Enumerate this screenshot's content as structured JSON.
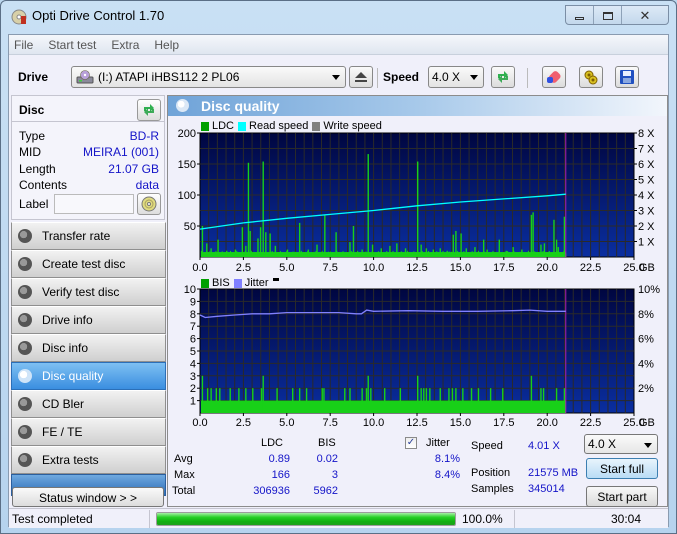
{
  "window": {
    "title": "Opti Drive Control 1.70",
    "controls": {
      "minimize": "minimize",
      "maximize": "maximize",
      "close": "close"
    }
  },
  "menu": [
    "File",
    "Start test",
    "Extra",
    "Help"
  ],
  "toolbar": {
    "drive_label": "Drive",
    "drive_value": "(I:)   ATAPI iHBS112   2 PL06",
    "speed_label": "Speed",
    "speed_value": "4.0 X",
    "icons": [
      "eject-icon",
      "refresh-icon",
      "erase-icon",
      "settings-icon",
      "save-icon"
    ]
  },
  "disc": {
    "title": "Disc",
    "rows": [
      {
        "key": "Type",
        "value": "BD-R"
      },
      {
        "key": "MID",
        "value": "MEIRA1 (001)"
      },
      {
        "key": "Length",
        "value": "21.07 GB"
      },
      {
        "key": "Contents",
        "value": "data"
      }
    ],
    "label_key": "Label",
    "label_value": ""
  },
  "nav": [
    {
      "label": "Transfer rate",
      "active": false
    },
    {
      "label": "Create test disc",
      "active": false
    },
    {
      "label": "Verify test disc",
      "active": false
    },
    {
      "label": "Drive info",
      "active": false
    },
    {
      "label": "Disc info",
      "active": false
    },
    {
      "label": "Disc quality",
      "active": true
    },
    {
      "label": "CD Bler",
      "active": false
    },
    {
      "label": "FE / TE",
      "active": false
    },
    {
      "label": "Extra tests",
      "active": false
    }
  ],
  "status_window_button": "Status window > >",
  "panel": {
    "title": "Disc quality"
  },
  "colors": {
    "ldc": "#00a000",
    "bis": "#00a000",
    "read_speed": "#00ffff",
    "write_speed": "#808080",
    "jitter": "#8080ff",
    "bar": "#18d018",
    "plot_bg_top": "#000640",
    "plot_bg_bottom": "#0a2ea0",
    "marker": "#b020b0",
    "value_text": "#1414c8"
  },
  "chart_data": [
    {
      "type": "bar",
      "title": "",
      "legend": [
        {
          "name": "LDC",
          "color": "#00a000"
        },
        {
          "name": "Read speed",
          "color": "#00ffff"
        },
        {
          "name": "Write speed",
          "color": "#808080"
        }
      ],
      "legend_position": "top-left",
      "xlabel": "GB",
      "xlim": [
        0,
        25
      ],
      "x_ticks": [
        "0.0",
        "2.5",
        "5.0",
        "7.5",
        "10.0",
        "12.5",
        "15.0",
        "17.5",
        "20.0",
        "22.5",
        "25.0"
      ],
      "ylim": [
        0,
        200
      ],
      "y_ticks": [
        "50",
        "100",
        "150",
        "200"
      ],
      "y2lim": [
        0,
        8
      ],
      "y2_ticks": [
        "1 X",
        "2 X",
        "3 X",
        "4 X",
        "5 X",
        "6 X",
        "7 X",
        "8 X"
      ],
      "grid": true,
      "end_marker_gb": 21.07,
      "series": [
        {
          "name": "LDC",
          "kind": "bar",
          "baseline": 8,
          "spikes": [
            {
              "x": 0.1,
              "y": 50
            },
            {
              "x": 0.35,
              "y": 22
            },
            {
              "x": 0.6,
              "y": 14
            },
            {
              "x": 1.0,
              "y": 28
            },
            {
              "x": 1.5,
              "y": 10
            },
            {
              "x": 2.0,
              "y": 12
            },
            {
              "x": 2.4,
              "y": 48
            },
            {
              "x": 2.6,
              "y": 18
            },
            {
              "x": 2.75,
              "y": 152
            },
            {
              "x": 2.85,
              "y": 42
            },
            {
              "x": 3.3,
              "y": 30
            },
            {
              "x": 3.45,
              "y": 48
            },
            {
              "x": 3.6,
              "y": 154
            },
            {
              "x": 3.75,
              "y": 40
            },
            {
              "x": 4.0,
              "y": 38
            },
            {
              "x": 4.3,
              "y": 18
            },
            {
              "x": 5.0,
              "y": 12
            },
            {
              "x": 5.7,
              "y": 55
            },
            {
              "x": 6.2,
              "y": 12
            },
            {
              "x": 6.7,
              "y": 20
            },
            {
              "x": 7.15,
              "y": 68
            },
            {
              "x": 7.8,
              "y": 40
            },
            {
              "x": 8.6,
              "y": 24
            },
            {
              "x": 8.8,
              "y": 50
            },
            {
              "x": 9.3,
              "y": 12
            },
            {
              "x": 9.65,
              "y": 166
            },
            {
              "x": 9.9,
              "y": 20
            },
            {
              "x": 10.4,
              "y": 14
            },
            {
              "x": 10.9,
              "y": 18
            },
            {
              "x": 11.3,
              "y": 22
            },
            {
              "x": 11.8,
              "y": 14
            },
            {
              "x": 12.5,
              "y": 154
            },
            {
              "x": 12.7,
              "y": 20
            },
            {
              "x": 13.0,
              "y": 14
            },
            {
              "x": 13.4,
              "y": 12
            },
            {
              "x": 13.8,
              "y": 14
            },
            {
              "x": 14.2,
              "y": 10
            },
            {
              "x": 14.55,
              "y": 36
            },
            {
              "x": 14.7,
              "y": 42
            },
            {
              "x": 15.0,
              "y": 38
            },
            {
              "x": 15.3,
              "y": 14
            },
            {
              "x": 15.8,
              "y": 16
            },
            {
              "x": 16.3,
              "y": 28
            },
            {
              "x": 16.5,
              "y": 12
            },
            {
              "x": 17.2,
              "y": 28
            },
            {
              "x": 17.6,
              "y": 10
            },
            {
              "x": 18.0,
              "y": 16
            },
            {
              "x": 18.5,
              "y": 12
            },
            {
              "x": 19.05,
              "y": 68
            },
            {
              "x": 19.15,
              "y": 72
            },
            {
              "x": 19.6,
              "y": 20
            },
            {
              "x": 19.8,
              "y": 22
            },
            {
              "x": 20.35,
              "y": 60
            },
            {
              "x": 20.5,
              "y": 28
            },
            {
              "x": 20.6,
              "y": 16
            },
            {
              "x": 20.95,
              "y": 65
            }
          ]
        },
        {
          "name": "Read speed",
          "kind": "line",
          "axis": "y2",
          "x": [
            0,
            2.5,
            5,
            7.5,
            10,
            12.5,
            15,
            17.5,
            20,
            21.07
          ],
          "y": [
            1.8,
            2.2,
            2.5,
            2.75,
            3.0,
            3.3,
            3.55,
            3.75,
            3.95,
            4.05
          ]
        }
      ]
    },
    {
      "type": "bar",
      "title": "",
      "legend": [
        {
          "name": "BIS",
          "color": "#00a000"
        },
        {
          "name": "Jitter",
          "color": "#8080ff"
        }
      ],
      "legend_position": "top-left",
      "xlabel": "GB",
      "xlim": [
        0,
        25
      ],
      "x_ticks": [
        "0.0",
        "2.5",
        "5.0",
        "7.5",
        "10.0",
        "12.5",
        "15.0",
        "17.5",
        "20.0",
        "22.5",
        "25.0"
      ],
      "ylim": [
        0,
        10
      ],
      "y_ticks": [
        "1",
        "2",
        "3",
        "4",
        "5",
        "6",
        "7",
        "8",
        "9",
        "10"
      ],
      "y2lim": [
        0,
        10
      ],
      "y2_ticks": [
        "2%",
        "4%",
        "6%",
        "8%",
        "10%"
      ],
      "grid": true,
      "end_marker_gb": 21.07,
      "series": [
        {
          "name": "BIS",
          "kind": "bar",
          "baseline": 1,
          "spikes": [
            {
              "x": 0.1,
              "y": 3
            },
            {
              "x": 0.4,
              "y": 2
            },
            {
              "x": 0.6,
              "y": 2
            },
            {
              "x": 0.9,
              "y": 2
            },
            {
              "x": 1.1,
              "y": 2
            },
            {
              "x": 1.7,
              "y": 2
            },
            {
              "x": 2.2,
              "y": 2
            },
            {
              "x": 2.6,
              "y": 2
            },
            {
              "x": 3.0,
              "y": 2
            },
            {
              "x": 3.5,
              "y": 2
            },
            {
              "x": 3.6,
              "y": 3
            },
            {
              "x": 4.4,
              "y": 2
            },
            {
              "x": 5.3,
              "y": 2
            },
            {
              "x": 5.7,
              "y": 2
            },
            {
              "x": 6.1,
              "y": 2
            },
            {
              "x": 7.0,
              "y": 2
            },
            {
              "x": 7.1,
              "y": 2
            },
            {
              "x": 8.3,
              "y": 2
            },
            {
              "x": 8.6,
              "y": 2
            },
            {
              "x": 9.3,
              "y": 2
            },
            {
              "x": 9.55,
              "y": 2
            },
            {
              "x": 9.65,
              "y": 3
            },
            {
              "x": 9.8,
              "y": 2
            },
            {
              "x": 10.6,
              "y": 2
            },
            {
              "x": 11.5,
              "y": 2
            },
            {
              "x": 12.5,
              "y": 3
            },
            {
              "x": 12.7,
              "y": 2
            },
            {
              "x": 12.85,
              "y": 2
            },
            {
              "x": 13.0,
              "y": 2
            },
            {
              "x": 13.2,
              "y": 2
            },
            {
              "x": 13.8,
              "y": 2
            },
            {
              "x": 14.3,
              "y": 2
            },
            {
              "x": 14.5,
              "y": 2
            },
            {
              "x": 14.7,
              "y": 2
            },
            {
              "x": 15.1,
              "y": 2
            },
            {
              "x": 15.6,
              "y": 2
            },
            {
              "x": 16.0,
              "y": 2
            },
            {
              "x": 16.7,
              "y": 2
            },
            {
              "x": 17.4,
              "y": 2
            },
            {
              "x": 19.05,
              "y": 3
            },
            {
              "x": 19.6,
              "y": 2
            },
            {
              "x": 19.75,
              "y": 2
            },
            {
              "x": 20.5,
              "y": 2
            },
            {
              "x": 20.95,
              "y": 2
            }
          ]
        },
        {
          "name": "Jitter",
          "kind": "line",
          "axis": "y2",
          "unit": "%",
          "x": [
            0,
            0.3,
            1,
            2,
            3,
            4,
            5,
            6,
            7,
            8,
            9,
            9.3,
            9.6,
            10,
            12,
            14,
            16,
            18,
            19,
            20,
            21.07
          ],
          "y": [
            7.9,
            7.7,
            7.8,
            7.9,
            8.0,
            8.0,
            8.1,
            8.1,
            8.1,
            8.1,
            8.0,
            8.0,
            8.3,
            8.2,
            8.25,
            8.2,
            8.2,
            8.25,
            8.3,
            8.2,
            8.2
          ]
        }
      ]
    }
  ],
  "stats": {
    "headers": {
      "ldc": "LDC",
      "bis": "BIS",
      "jitter": "Jitter"
    },
    "jitter_checked": true,
    "rows": [
      {
        "label": "Avg",
        "ldc": "0.89",
        "bis": "0.02",
        "jitter": "8.1%"
      },
      {
        "label": "Max",
        "ldc": "166",
        "bis": "3",
        "jitter": "8.4%"
      },
      {
        "label": "Total",
        "ldc": "306936",
        "bis": "5962",
        "jitter": ""
      }
    ],
    "speed_label": "Speed",
    "speed_value": "4.01 X",
    "position_label": "Position",
    "position_value": "21575 MB",
    "samples_label": "Samples",
    "samples_value": "345014",
    "speed_select": "4.0 X",
    "start_full": "Start full",
    "start_part": "Start part"
  },
  "statusbar": {
    "text": "Test completed",
    "progress": 100.0,
    "progress_label": "100.0%",
    "elapsed": "30:04"
  }
}
